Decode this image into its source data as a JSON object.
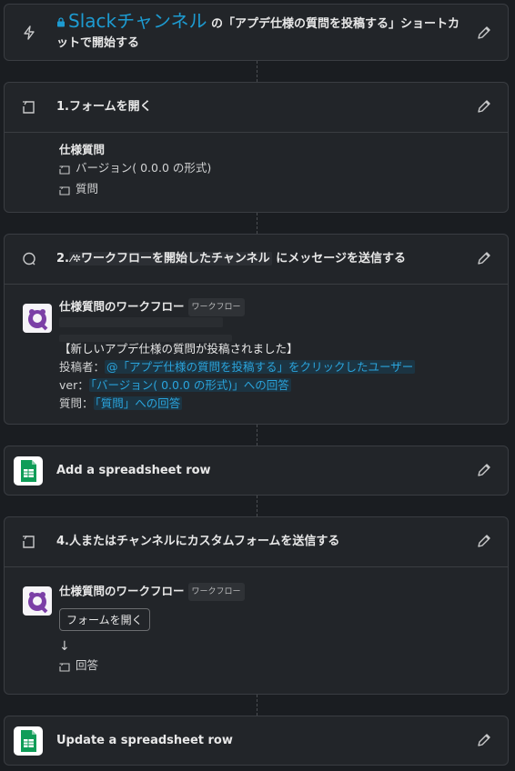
{
  "trigger": {
    "channel_label": "Slackチャンネル",
    "text_after": "の「アプデ仕様の質問を投稿する」ショートカットで開始する"
  },
  "step1": {
    "title": "1.フォームを開く",
    "form_title": "仕様質問",
    "fields": [
      "バージョン( 0.0.0 の形式)",
      "質問"
    ]
  },
  "step2": {
    "title_prefix": "2.",
    "channel_chip": "ワークフローを開始したチャンネル",
    "title_suffix": "にメッセージを送信する",
    "sender_name": "仕様質問のワークフロー",
    "sender_tag": "ワークフロー",
    "headline": "【新しいアプデ仕様の質問が投稿されました】",
    "lines": [
      {
        "label": "投稿者：",
        "value": "@「アプデ仕様の質問を投稿する」をクリックしたユーザー"
      },
      {
        "label": "ver：",
        "value": "「バージョン( 0.0.0 の形式)」への回答"
      },
      {
        "label": "質問：",
        "value": "「質問」への回答"
      }
    ]
  },
  "step3": {
    "title": "Add a spreadsheet row"
  },
  "step4": {
    "title": "4.人またはチャンネルにカスタムフォームを送信する",
    "sender_name": "仕様質問のワークフロー",
    "sender_tag": "ワークフロー",
    "button_label": "フォームを開く",
    "arrow": "↓",
    "result_label": "回答"
  },
  "step5": {
    "title": "Update a spreadsheet row"
  },
  "colors": {
    "background": "#1a1d21",
    "card": "#222529",
    "link": "#1d9bd1",
    "sheets_green": "#0f9d58"
  }
}
